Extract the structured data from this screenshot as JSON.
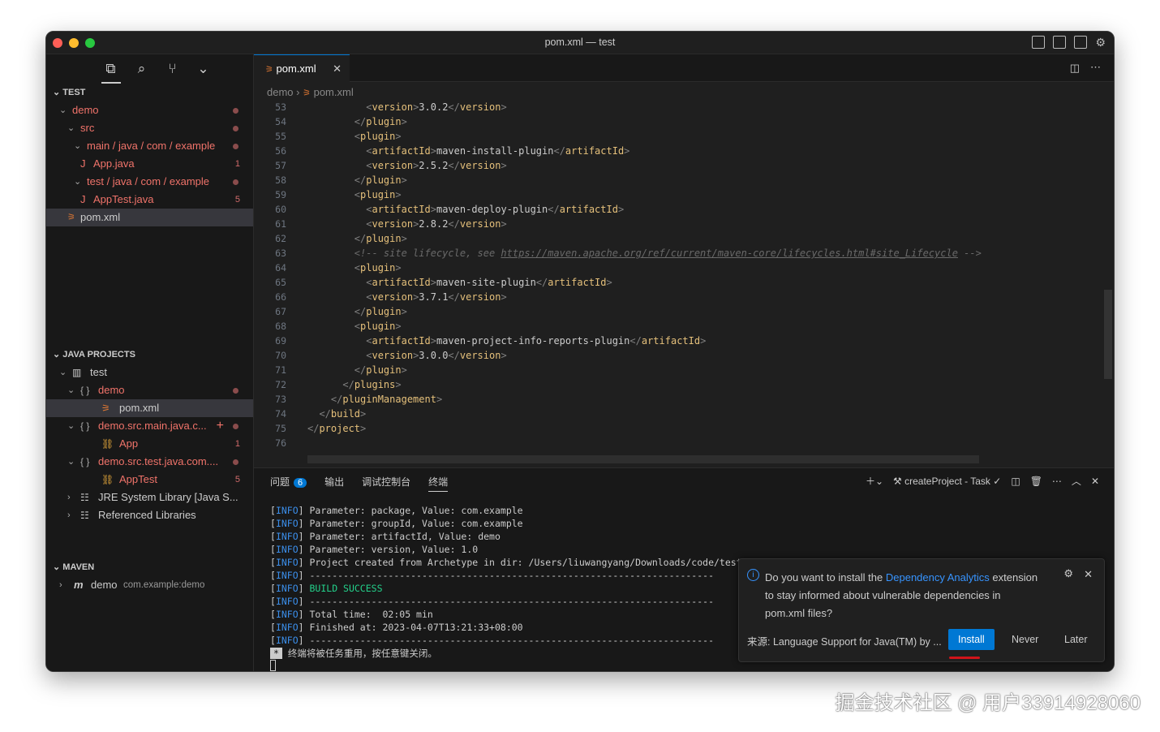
{
  "window": {
    "title": "pom.xml — test"
  },
  "activity": [
    "explorer-icon",
    "search-icon",
    "source-control-icon",
    "chevron-down-icon"
  ],
  "explorer": {
    "section": "TEST",
    "items": [
      {
        "label": "demo",
        "badge": ""
      },
      {
        "label": "src",
        "badge": ""
      },
      {
        "label": "main / java / com / example",
        "badge": ""
      },
      {
        "label": "App.java",
        "badge": "1"
      },
      {
        "label": "test / java / com / example",
        "badge": ""
      },
      {
        "label": "AppTest.java",
        "badge": "5"
      },
      {
        "label": "pom.xml",
        "badge": ""
      }
    ]
  },
  "java_projects": {
    "section": "JAVA PROJECTS",
    "items": [
      {
        "label": "test"
      },
      {
        "label": "demo"
      },
      {
        "label": "pom.xml"
      },
      {
        "label": "demo.src.main.java.c...",
        "badge": ""
      },
      {
        "label": "App",
        "badge": "1"
      },
      {
        "label": "demo.src.test.java.com...."
      },
      {
        "label": "AppTest",
        "badge": "5"
      },
      {
        "label": "JRE System Library [Java S..."
      },
      {
        "label": "Referenced Libraries"
      }
    ]
  },
  "maven": {
    "section": "MAVEN",
    "item": "demo",
    "detail": "com.example:demo"
  },
  "editor": {
    "tab": "pom.xml",
    "breadcrumb": [
      "demo",
      "pom.xml"
    ],
    "lines": [
      {
        "n": "53",
        "text": "          <version>3.0.2</version>"
      },
      {
        "n": "54",
        "text": "        </plugin>"
      },
      {
        "n": "55",
        "text": "        <plugin>"
      },
      {
        "n": "56",
        "text": "          <artifactId>maven-install-plugin</artifactId>"
      },
      {
        "n": "57",
        "text": "          <version>2.5.2</version>"
      },
      {
        "n": "58",
        "text": "        </plugin>"
      },
      {
        "n": "59",
        "text": "        <plugin>"
      },
      {
        "n": "60",
        "text": "          <artifactId>maven-deploy-plugin</artifactId>"
      },
      {
        "n": "61",
        "text": "          <version>2.8.2</version>"
      },
      {
        "n": "62",
        "text": "        </plugin>"
      },
      {
        "n": "63",
        "text": "        <!-- site lifecycle, see https://maven.apache.org/ref/current/maven-core/lifecycles.html#site_Lifecycle -->"
      },
      {
        "n": "64",
        "text": "        <plugin>"
      },
      {
        "n": "65",
        "text": "          <artifactId>maven-site-plugin</artifactId>"
      },
      {
        "n": "66",
        "text": "          <version>3.7.1</version>"
      },
      {
        "n": "67",
        "text": "        </plugin>"
      },
      {
        "n": "68",
        "text": "        <plugin>"
      },
      {
        "n": "69",
        "text": "          <artifactId>maven-project-info-reports-plugin</artifactId>"
      },
      {
        "n": "70",
        "text": "          <version>3.0.0</version>"
      },
      {
        "n": "71",
        "text": "        </plugin>"
      },
      {
        "n": "72",
        "text": "      </plugins>"
      },
      {
        "n": "73",
        "text": "    </pluginManagement>"
      },
      {
        "n": "74",
        "text": "  </build>"
      },
      {
        "n": "75",
        "text": "</project>"
      },
      {
        "n": "76",
        "text": ""
      }
    ]
  },
  "panel": {
    "tabs": [
      "问题",
      "输出",
      "调试控制台",
      "终端"
    ],
    "problems_count": "6",
    "task": "createProject - Task",
    "terminal": [
      "Parameter: package, Value: com.example",
      "Parameter: groupId, Value: com.example",
      "Parameter: artifactId, Value: demo",
      "Parameter: version, Value: 1.0",
      "Project created from Archetype in dir: /Users/liuwangyang/Downloads/code/test",
      "------------------------------------------------------------------------",
      "BUILD SUCCESS",
      "------------------------------------------------------------------------",
      "Total time:  02:05 min",
      "Finished at: 2023-04-07T13:21:33+08:00",
      "------------------------------------------------------------------------"
    ],
    "info_tag": "INFO",
    "reuse_msg": "终端将被任务重用，按任意键关闭。"
  },
  "notification": {
    "pre": "Do you want to install the ",
    "link": "Dependency Analytics",
    "post": " extension",
    "line2": "to stay informed about vulnerable dependencies in",
    "line3": "pom.xml files?",
    "source": "来源: Language Support for Java(TM) by ...",
    "install": "Install",
    "never": "Never",
    "later": "Later"
  },
  "watermark": "掘金技术社区 @ 用户33914928060",
  "colors": {
    "accent": "#0078d4",
    "error": "#f0736a",
    "tag": "#e5c07b"
  }
}
